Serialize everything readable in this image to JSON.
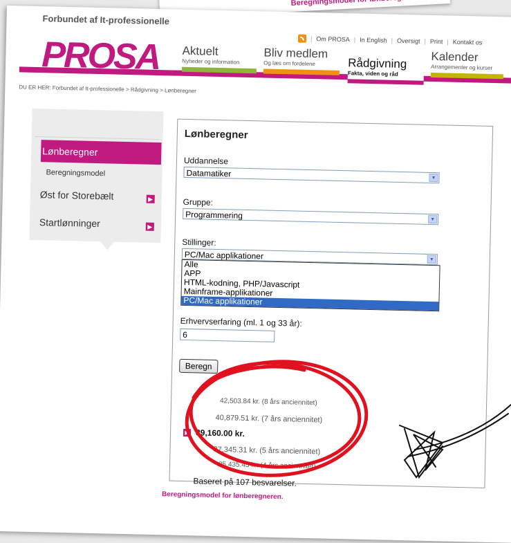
{
  "backsheet_text": "Beregningsmodel for lønberegneren",
  "header": {
    "org_name": "Forbundet af It-professionelle",
    "logo_text": "PROSA",
    "top_links": [
      "Om PROSA",
      "In English",
      "Oversigt",
      "Print",
      "Kontakt os"
    ]
  },
  "nav": [
    {
      "title": "Aktuelt",
      "sub": "Nyheder og information",
      "color": "#8fb33b"
    },
    {
      "title": "Bliv medlem",
      "sub": "Og læs om fordelene",
      "color": "#f29111"
    },
    {
      "title": "Rådgivning",
      "sub": "Fakta, viden og råd",
      "color": "#c0197f"
    },
    {
      "title": "Kalender",
      "sub": "Arrangementer og kurser",
      "color": "#c5b500"
    }
  ],
  "breadcrumb": "DU ER HER: Forbundet af It-professionelle  >  Rådgivning  >  Lønberegner",
  "sidebar": {
    "active": "Lønberegner",
    "sub": "Beregningsmodel",
    "items": [
      "Øst for Storebælt",
      "Startlønninger"
    ]
  },
  "calculator": {
    "title": "Lønberegner",
    "education_label": "Uddannelse",
    "education_value": "Datamatiker",
    "group_label": "Gruppe:",
    "group_value": "Programmering",
    "positions_label": "Stillinger:",
    "positions_value": "PC/Mac applikationer",
    "positions_options": [
      "Alle",
      "APP",
      "HTML-kodning, PHP/Javascript",
      "Mainframe-applikationer",
      "PC/Mac applikationer"
    ],
    "experience_label": "Erhvervserfaring (ml. 1 og 33 år):",
    "experience_value": "6",
    "calc_button": "Beregn",
    "results": [
      "42,503.84 kr. (8 års anciennitet)",
      "40,879.51 kr. (7 års anciennitet)",
      "39,160.00 kr.",
      "37,345.31 kr. (5 års anciennitet)",
      "35,435.45 kr. (4 års anciennitet)"
    ],
    "based_on": "Baseret på 107 besvarelser."
  },
  "footer_link": "Beregningsmodel for lønberegneren.",
  "colors": {
    "brand": "#c0197f",
    "circle": "#e0121f"
  }
}
